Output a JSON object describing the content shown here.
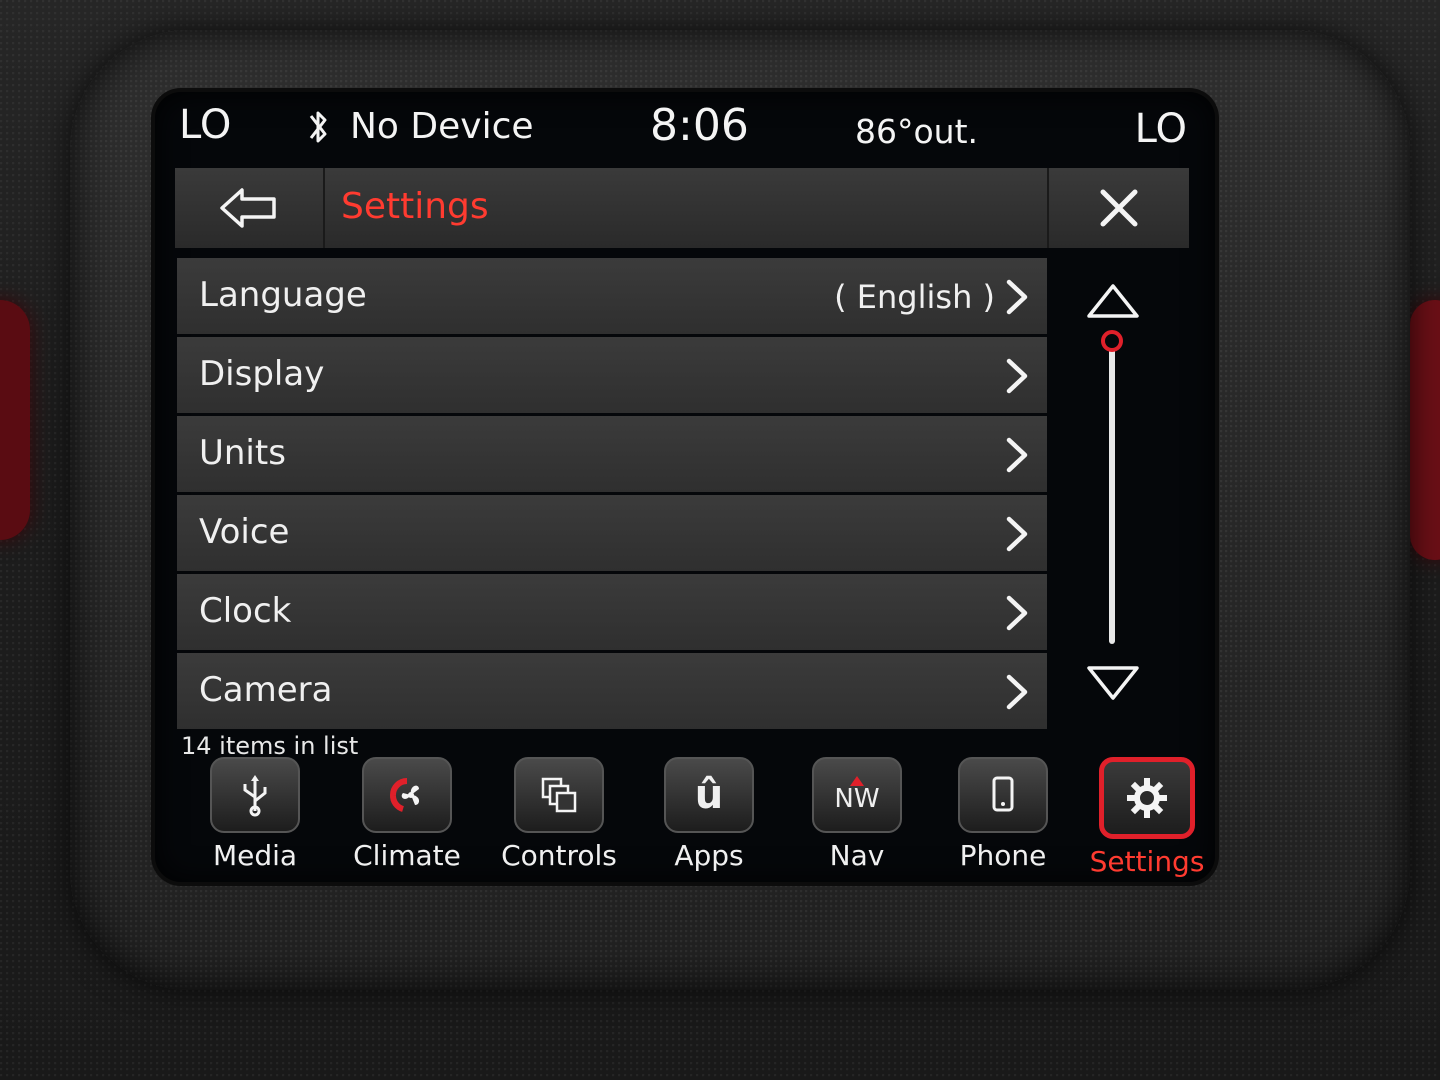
{
  "status_bar": {
    "left_zone": "LO",
    "device": "No Device",
    "time": "8:06",
    "temperature": "86°out.",
    "right_zone": "LO"
  },
  "header": {
    "title": "Settings"
  },
  "settings_list": {
    "items": [
      {
        "label": "Language",
        "value": "( English )"
      },
      {
        "label": "Display",
        "value": ""
      },
      {
        "label": "Units",
        "value": ""
      },
      {
        "label": "Voice",
        "value": ""
      },
      {
        "label": "Clock",
        "value": ""
      },
      {
        "label": "Camera",
        "value": ""
      }
    ],
    "count_text": "14 items in list"
  },
  "dock": {
    "items": [
      {
        "label": "Media",
        "icon": "usb-icon"
      },
      {
        "label": "Climate",
        "icon": "fan-icon"
      },
      {
        "label": "Controls",
        "icon": "controls-icon"
      },
      {
        "label": "Apps",
        "icon": "apps-icon",
        "glyph": "û"
      },
      {
        "label": "Nav",
        "icon": "compass-icon",
        "glyph": "NW"
      },
      {
        "label": "Phone",
        "icon": "phone-icon"
      },
      {
        "label": "Settings",
        "icon": "gear-icon"
      }
    ],
    "active": "Settings"
  },
  "colors": {
    "accent": "#e0202a",
    "title": "#ff3b30",
    "row_bg": "#353535",
    "screen_bg": "#05070a"
  }
}
